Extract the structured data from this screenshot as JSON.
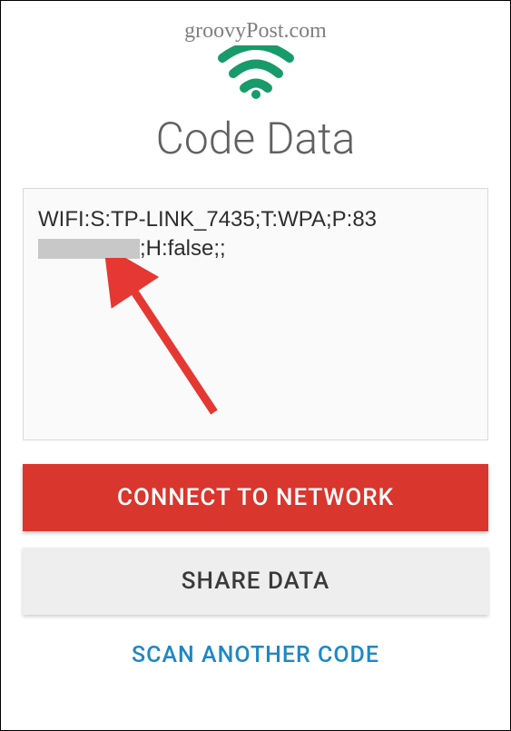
{
  "watermark": "groovyPost.com",
  "title": "Code Data",
  "wifi_data": {
    "prefix": "WIFI:S:TP-LINK_7435;T:WPA;P:83",
    "suffix": ";H:false;;"
  },
  "buttons": {
    "connect": "CONNECT TO NETWORK",
    "share": "SHARE DATA",
    "scan": "SCAN ANOTHER CODE"
  },
  "colors": {
    "accent_green": "#189b6b",
    "primary_red": "#d9362d",
    "link_blue": "#1e88c3"
  }
}
